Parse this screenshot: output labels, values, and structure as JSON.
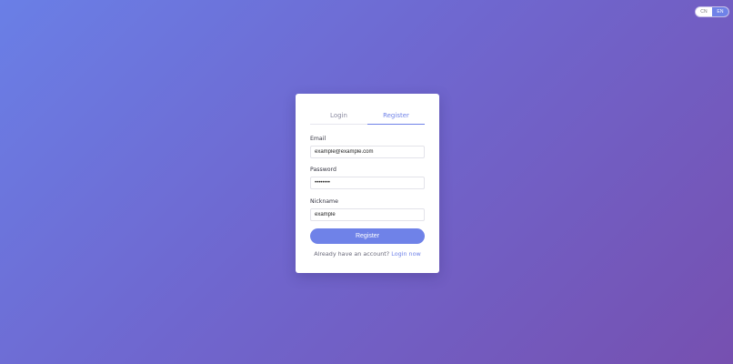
{
  "language": {
    "options": [
      "CN",
      "EN"
    ],
    "active": "EN"
  },
  "tabs": {
    "login": "Login",
    "register": "Register",
    "active": "Register"
  },
  "form": {
    "email": {
      "label": "Email",
      "value": "example@example.com"
    },
    "password": {
      "label": "Password",
      "value": "••••••••"
    },
    "nickname": {
      "label": "Nickname",
      "value": "example"
    },
    "submit_label": "Register"
  },
  "footer": {
    "prompt": "Already have an account?",
    "link": "Login now"
  },
  "colors": {
    "accent": "#6f82e8",
    "background_start": "#6a7fe6",
    "background_end": "#7650b0"
  }
}
